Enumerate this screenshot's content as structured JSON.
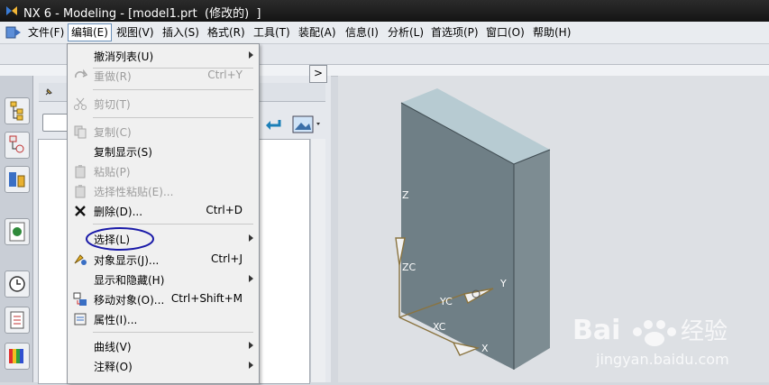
{
  "window": {
    "title": "NX 6 - Modeling - [model1.prt  (修改的)  ]"
  },
  "menubar": [
    {
      "label": "文件(F)"
    },
    {
      "label": "编辑(E)"
    },
    {
      "label": "视图(V)"
    },
    {
      "label": "插入(S)"
    },
    {
      "label": "格式(R)"
    },
    {
      "label": "工具(T)"
    },
    {
      "label": "装配(A)"
    },
    {
      "label": "信息(I)"
    },
    {
      "label": "分析(L)"
    },
    {
      "label": "首选项(P)"
    },
    {
      "label": "窗口(O)"
    },
    {
      "label": "帮助(H)"
    }
  ],
  "edit_menu": {
    "items": [
      {
        "label": "撤消列表(U)",
        "shortcut": "",
        "submenu": true,
        "disabled": false,
        "icon": "none"
      },
      {
        "label": "重做(R)",
        "shortcut": "Ctrl+Y",
        "submenu": false,
        "disabled": true,
        "icon": "redo-icon"
      },
      {
        "label": "剪切(T)",
        "shortcut": "",
        "submenu": false,
        "disabled": true,
        "icon": "scissors-icon"
      },
      {
        "label": "复制(C)",
        "shortcut": "",
        "submenu": false,
        "disabled": true,
        "icon": "copy-icon"
      },
      {
        "label": "复制显示(S)",
        "shortcut": "",
        "submenu": false,
        "disabled": false,
        "icon": "none"
      },
      {
        "label": "粘贴(P)",
        "shortcut": "",
        "submenu": false,
        "disabled": true,
        "icon": "paste-icon"
      },
      {
        "label": "选择性粘贴(E)...",
        "shortcut": "",
        "submenu": false,
        "disabled": true,
        "icon": "paste-special-icon"
      },
      {
        "label": "删除(D)...",
        "shortcut": "Ctrl+D",
        "submenu": false,
        "disabled": false,
        "icon": "delete-x-icon"
      },
      {
        "label": "选择(L)",
        "shortcut": "",
        "submenu": true,
        "disabled": false,
        "icon": "none"
      },
      {
        "label": "对象显示(J)...",
        "shortcut": "Ctrl+J",
        "submenu": false,
        "disabled": false,
        "icon": "object-display-icon"
      },
      {
        "label": "显示和隐藏(H)",
        "shortcut": "",
        "submenu": true,
        "disabled": false,
        "icon": "none"
      },
      {
        "label": "移动对象(O)...",
        "shortcut": "Ctrl+Shift+M",
        "submenu": false,
        "disabled": false,
        "icon": "move-object-icon"
      },
      {
        "label": "属性(I)...",
        "shortcut": "",
        "submenu": false,
        "disabled": false,
        "icon": "properties-icon"
      },
      {
        "label": "曲线(V)",
        "shortcut": "",
        "submenu": true,
        "disabled": false,
        "icon": "none"
      },
      {
        "label": "注释(O)",
        "shortcut": "",
        "submenu": true,
        "disabled": false,
        "icon": "none"
      }
    ]
  },
  "triad": {
    "z": "Z",
    "zc": "ZC",
    "yc": "YC",
    "y": "Y",
    "xc": "XC",
    "x": "X"
  },
  "colors": {
    "accent_circle": "#1a1aa8",
    "model_front": "#6f7f86",
    "model_top": "#b7cbd2",
    "model_side": "#7d8c92"
  }
}
